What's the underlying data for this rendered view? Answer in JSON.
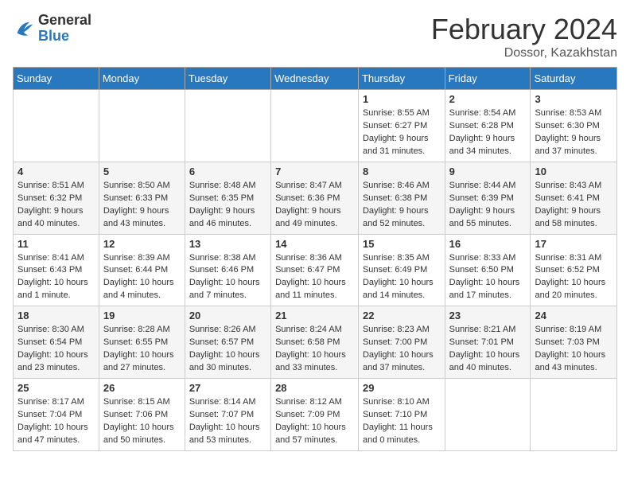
{
  "header": {
    "logo_general": "General",
    "logo_blue": "Blue",
    "month_year": "February 2024",
    "location": "Dossor, Kazakhstan"
  },
  "weekdays": [
    "Sunday",
    "Monday",
    "Tuesday",
    "Wednesday",
    "Thursday",
    "Friday",
    "Saturday"
  ],
  "weeks": [
    [
      {
        "day": "",
        "info": ""
      },
      {
        "day": "",
        "info": ""
      },
      {
        "day": "",
        "info": ""
      },
      {
        "day": "",
        "info": ""
      },
      {
        "day": "1",
        "info": "Sunrise: 8:55 AM\nSunset: 6:27 PM\nDaylight: 9 hours and 31 minutes."
      },
      {
        "day": "2",
        "info": "Sunrise: 8:54 AM\nSunset: 6:28 PM\nDaylight: 9 hours and 34 minutes."
      },
      {
        "day": "3",
        "info": "Sunrise: 8:53 AM\nSunset: 6:30 PM\nDaylight: 9 hours and 37 minutes."
      }
    ],
    [
      {
        "day": "4",
        "info": "Sunrise: 8:51 AM\nSunset: 6:32 PM\nDaylight: 9 hours and 40 minutes."
      },
      {
        "day": "5",
        "info": "Sunrise: 8:50 AM\nSunset: 6:33 PM\nDaylight: 9 hours and 43 minutes."
      },
      {
        "day": "6",
        "info": "Sunrise: 8:48 AM\nSunset: 6:35 PM\nDaylight: 9 hours and 46 minutes."
      },
      {
        "day": "7",
        "info": "Sunrise: 8:47 AM\nSunset: 6:36 PM\nDaylight: 9 hours and 49 minutes."
      },
      {
        "day": "8",
        "info": "Sunrise: 8:46 AM\nSunset: 6:38 PM\nDaylight: 9 hours and 52 minutes."
      },
      {
        "day": "9",
        "info": "Sunrise: 8:44 AM\nSunset: 6:39 PM\nDaylight: 9 hours and 55 minutes."
      },
      {
        "day": "10",
        "info": "Sunrise: 8:43 AM\nSunset: 6:41 PM\nDaylight: 9 hours and 58 minutes."
      }
    ],
    [
      {
        "day": "11",
        "info": "Sunrise: 8:41 AM\nSunset: 6:43 PM\nDaylight: 10 hours and 1 minute."
      },
      {
        "day": "12",
        "info": "Sunrise: 8:39 AM\nSunset: 6:44 PM\nDaylight: 10 hours and 4 minutes."
      },
      {
        "day": "13",
        "info": "Sunrise: 8:38 AM\nSunset: 6:46 PM\nDaylight: 10 hours and 7 minutes."
      },
      {
        "day": "14",
        "info": "Sunrise: 8:36 AM\nSunset: 6:47 PM\nDaylight: 10 hours and 11 minutes."
      },
      {
        "day": "15",
        "info": "Sunrise: 8:35 AM\nSunset: 6:49 PM\nDaylight: 10 hours and 14 minutes."
      },
      {
        "day": "16",
        "info": "Sunrise: 8:33 AM\nSunset: 6:50 PM\nDaylight: 10 hours and 17 minutes."
      },
      {
        "day": "17",
        "info": "Sunrise: 8:31 AM\nSunset: 6:52 PM\nDaylight: 10 hours and 20 minutes."
      }
    ],
    [
      {
        "day": "18",
        "info": "Sunrise: 8:30 AM\nSunset: 6:54 PM\nDaylight: 10 hours and 23 minutes."
      },
      {
        "day": "19",
        "info": "Sunrise: 8:28 AM\nSunset: 6:55 PM\nDaylight: 10 hours and 27 minutes."
      },
      {
        "day": "20",
        "info": "Sunrise: 8:26 AM\nSunset: 6:57 PM\nDaylight: 10 hours and 30 minutes."
      },
      {
        "day": "21",
        "info": "Sunrise: 8:24 AM\nSunset: 6:58 PM\nDaylight: 10 hours and 33 minutes."
      },
      {
        "day": "22",
        "info": "Sunrise: 8:23 AM\nSunset: 7:00 PM\nDaylight: 10 hours and 37 minutes."
      },
      {
        "day": "23",
        "info": "Sunrise: 8:21 AM\nSunset: 7:01 PM\nDaylight: 10 hours and 40 minutes."
      },
      {
        "day": "24",
        "info": "Sunrise: 8:19 AM\nSunset: 7:03 PM\nDaylight: 10 hours and 43 minutes."
      }
    ],
    [
      {
        "day": "25",
        "info": "Sunrise: 8:17 AM\nSunset: 7:04 PM\nDaylight: 10 hours and 47 minutes."
      },
      {
        "day": "26",
        "info": "Sunrise: 8:15 AM\nSunset: 7:06 PM\nDaylight: 10 hours and 50 minutes."
      },
      {
        "day": "27",
        "info": "Sunrise: 8:14 AM\nSunset: 7:07 PM\nDaylight: 10 hours and 53 minutes."
      },
      {
        "day": "28",
        "info": "Sunrise: 8:12 AM\nSunset: 7:09 PM\nDaylight: 10 hours and 57 minutes."
      },
      {
        "day": "29",
        "info": "Sunrise: 8:10 AM\nSunset: 7:10 PM\nDaylight: 11 hours and 0 minutes."
      },
      {
        "day": "",
        "info": ""
      },
      {
        "day": "",
        "info": ""
      }
    ]
  ]
}
